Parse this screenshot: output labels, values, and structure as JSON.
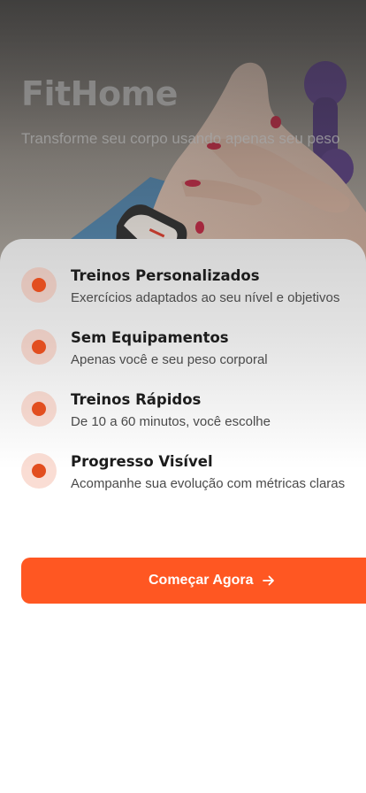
{
  "hero": {
    "title": "FitHome",
    "subtitle": "Transforme seu corpo usando apenas seu peso"
  },
  "features": [
    {
      "title": "Treinos Personalizados",
      "description": "Exercícios adaptados ao seu nível e objetivos"
    },
    {
      "title": "Sem Equipamentos",
      "description": "Apenas você e seu peso corporal"
    },
    {
      "title": "Treinos Rápidos",
      "description": "De 10 a 60 minutos, você escolhe"
    },
    {
      "title": "Progresso Visível",
      "description": "Acompanhe sua evolução com métricas claras"
    }
  ],
  "cta": {
    "label": "Começar Agora",
    "icon": "arrow-right-icon"
  },
  "colors": {
    "accent": "#ff5722",
    "dot": "#e24e1f"
  }
}
